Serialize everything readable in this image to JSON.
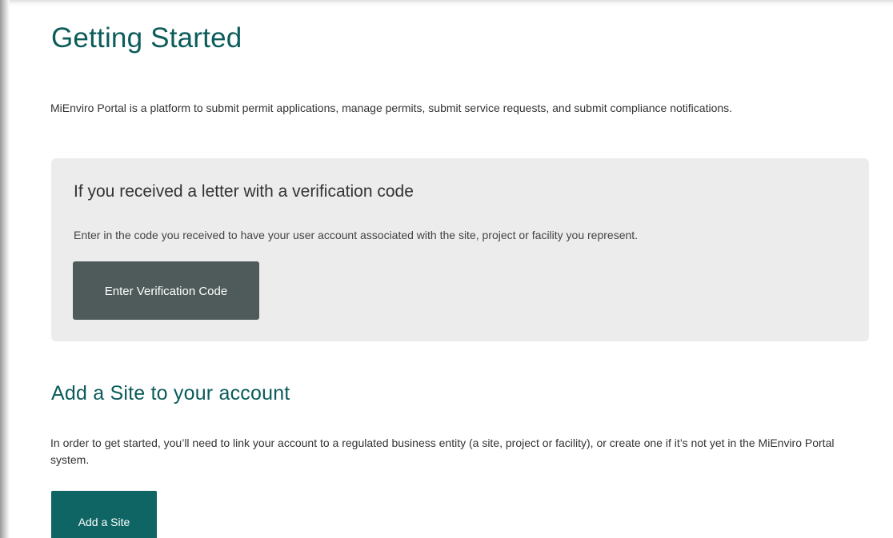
{
  "page": {
    "title": "Getting Started",
    "intro": "MiEnviro Portal is a platform to submit permit applications, manage permits, submit service requests, and submit compliance notifications."
  },
  "verification": {
    "heading": "If you received a letter with a verification code",
    "text": "Enter in the code you received to have your user account associated with the site, project or facility you represent.",
    "button_label": "Enter Verification Code"
  },
  "add_site": {
    "heading": "Add a Site to your account",
    "text": "In order to get started, you’ll need to link your account to a regulated business entity (a site, project or facility), or create one if it’s not yet in the MiEnviro Portal system.",
    "button_label": "Add a Site"
  },
  "colors": {
    "heading": "#0b5c5a",
    "primary_button": "#0f6563",
    "secondary_button": "#4f5b5a",
    "panel_background": "#ececec"
  }
}
